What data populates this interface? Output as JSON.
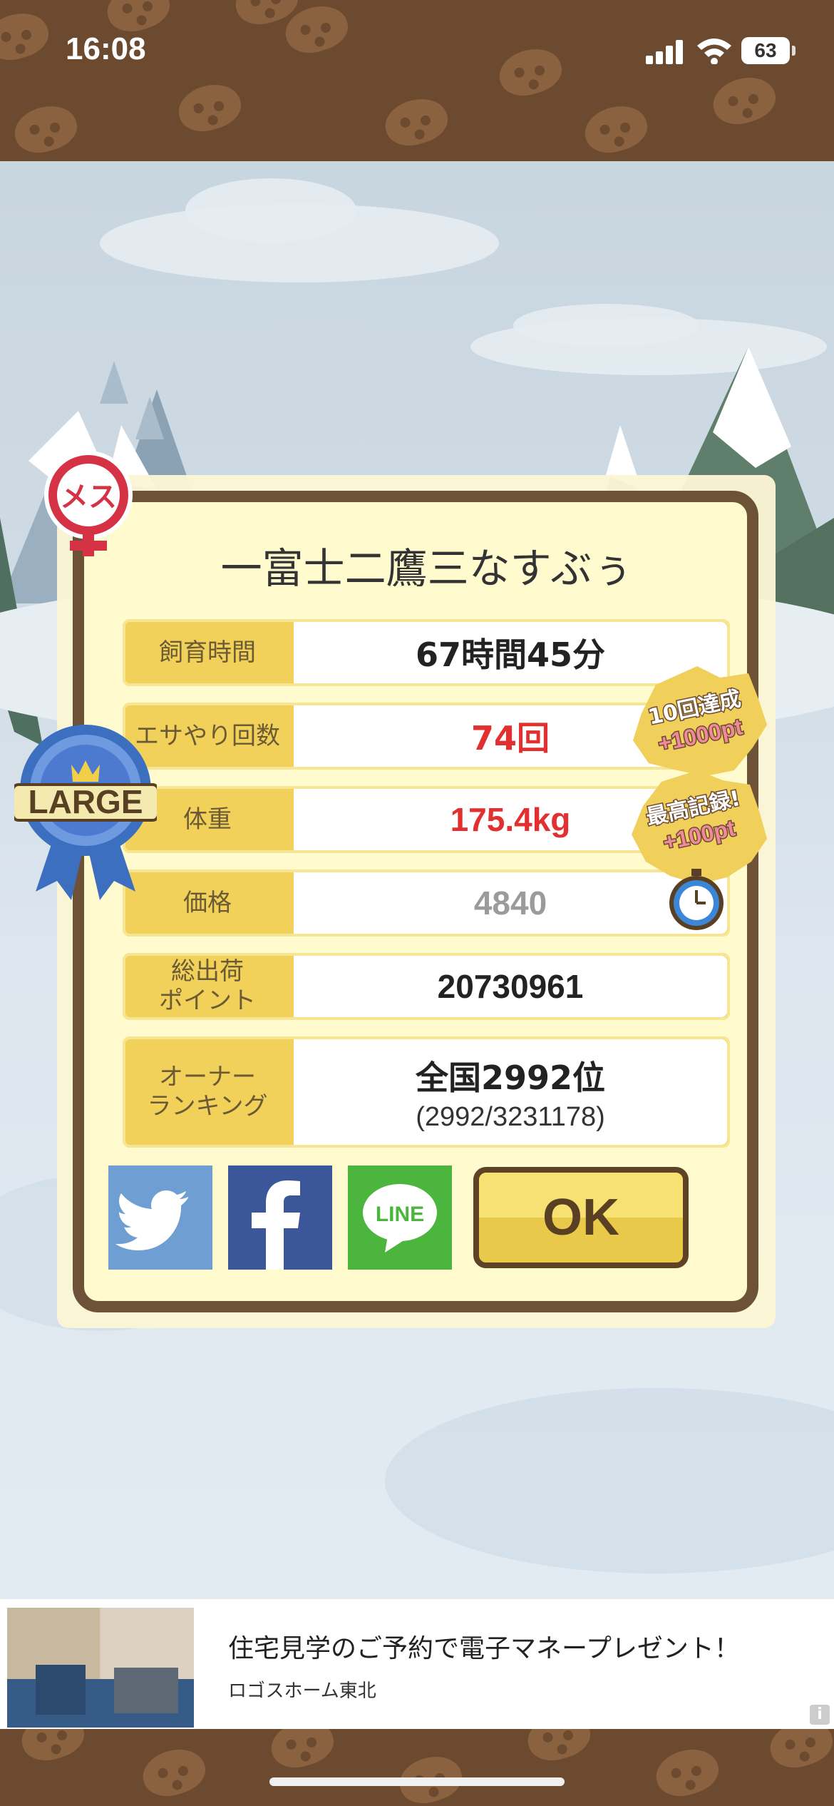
{
  "status_bar": {
    "time": "16:08",
    "battery": "63"
  },
  "dialog": {
    "title": "一富士二鷹三なすぶぅ",
    "rows": [
      {
        "label": "飼育時間",
        "value": "67時間45分"
      },
      {
        "label": "エサやり回数",
        "value": "74回"
      },
      {
        "label": "体重",
        "value": "175.4kg"
      },
      {
        "label": "価格",
        "value": "4840"
      },
      {
        "label": "総出荷\nポイント",
        "value": "20730961"
      },
      {
        "label": "オーナー\nランキング",
        "value": "全国2992位",
        "sub": "(2992/3231178)"
      }
    ],
    "ok_label": "OK",
    "share": {
      "line_label": "LINE"
    }
  },
  "badges": {
    "female": "メス",
    "size": "LARGE",
    "achievement_1_line1": "10回達成",
    "achievement_1_line2": "+1000pt",
    "achievement_2_line1": "最高記録!",
    "achievement_2_line2": "+100pt"
  },
  "ad": {
    "title": "住宅見学のご予約で電子マネープレゼント！",
    "advertiser": "ロゴスホーム東北",
    "info": "i"
  },
  "colors": {
    "brown": "#6b4a2f",
    "label_yellow": "#f2d15b",
    "highlight_red": "#e23030",
    "twitter": "#6f9fd2",
    "facebook": "#3b5799",
    "line": "#4cb53d"
  }
}
